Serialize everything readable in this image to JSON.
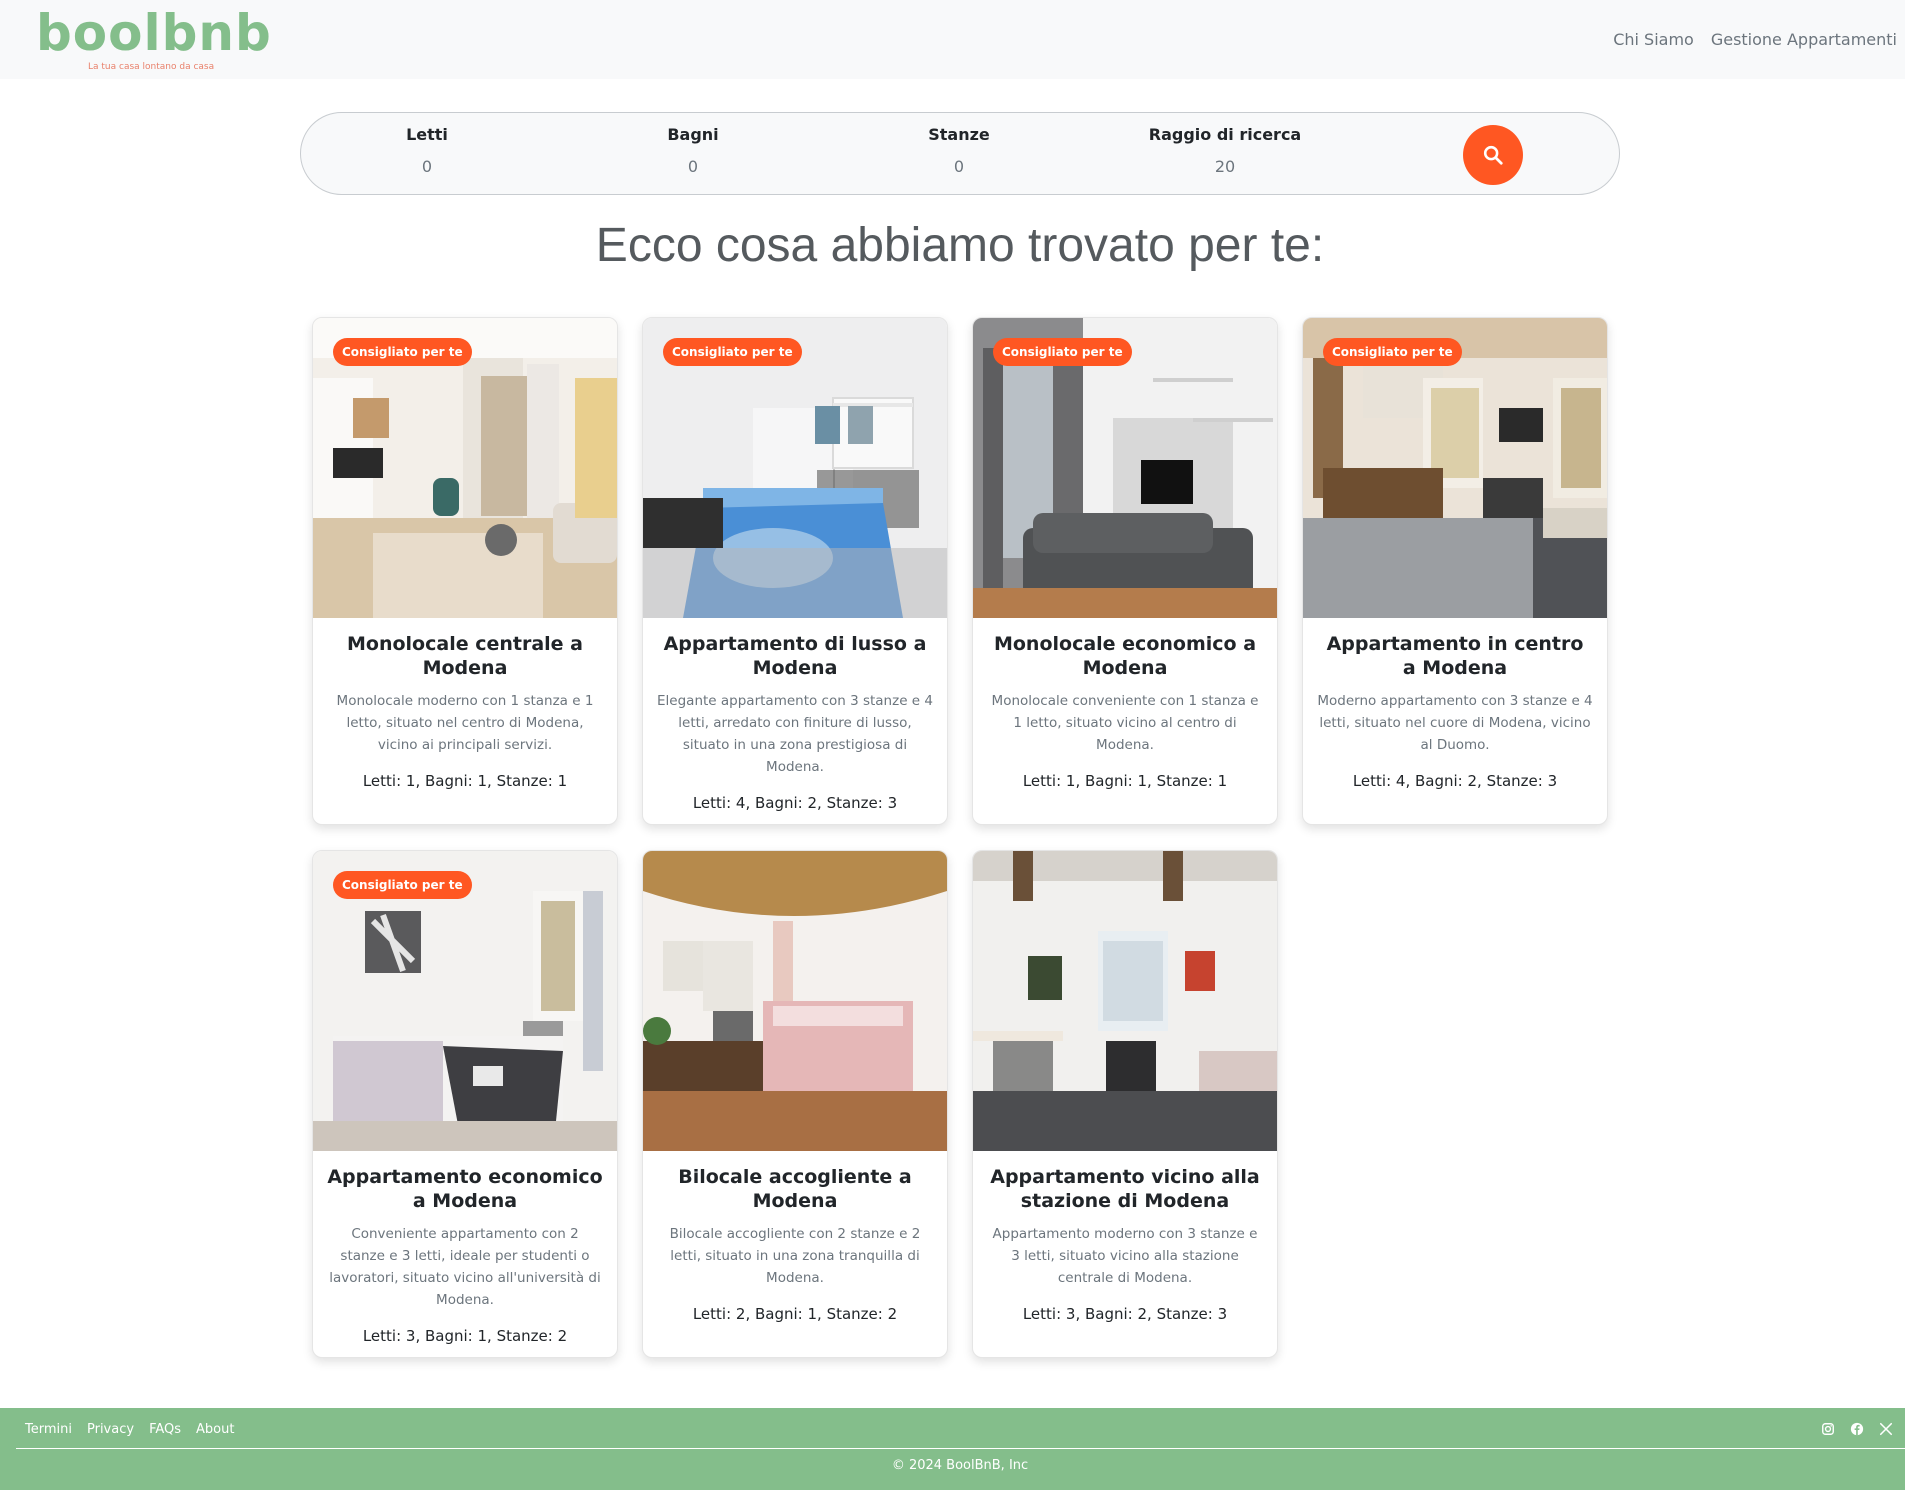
{
  "brand": {
    "logo_text": "boolbnb",
    "tagline": "La tua casa lontano da casa",
    "primary_color": "#84be8b",
    "accent_color": "#ff5722"
  },
  "nav": {
    "links": [
      "Chi Siamo",
      "Gestione Appartamenti"
    ]
  },
  "search": {
    "fields": [
      {
        "label": "Letti",
        "value": "0"
      },
      {
        "label": "Bagni",
        "value": "0"
      },
      {
        "label": "Stanze",
        "value": "0"
      },
      {
        "label": "Raggio di ricerca",
        "value": "20"
      }
    ],
    "button_icon": "search-icon"
  },
  "results_heading": "Ecco cosa abbiamo trovato per te:",
  "badge_label": "Consigliato per te",
  "apartments": [
    {
      "title": "Monolocale centrale a Modena",
      "description": "Monolocale moderno con 1 stanza e 1 letto, situato nel centro di Modena, vicino ai principali servizi.",
      "specs": "Letti: 1, Bagni: 1, Stanze: 1",
      "recommended": true
    },
    {
      "title": "Appartamento di lusso a Modena",
      "description": "Elegante appartamento con 3 stanze e 4 letti, arredato con finiture di lusso, situato in una zona prestigiosa di Modena.",
      "specs": "Letti: 4, Bagni: 2, Stanze: 3",
      "recommended": true
    },
    {
      "title": "Monolocale economico a Modena",
      "description": "Monolocale conveniente con 1 stanza e 1 letto, situato vicino al centro di Modena.",
      "specs": "Letti: 1, Bagni: 1, Stanze: 1",
      "recommended": true
    },
    {
      "title": "Appartamento in centro a Modena",
      "description": "Moderno appartamento con 3 stanze e 4 letti, situato nel cuore di Modena, vicino al Duomo.",
      "specs": "Letti: 4, Bagni: 2, Stanze: 3",
      "recommended": true
    },
    {
      "title": "Appartamento economico a Modena",
      "description": "Conveniente appartamento con 2 stanze e 3 letti, ideale per studenti o lavoratori, situato vicino all'università di Modena.",
      "specs": "Letti: 3, Bagni: 1, Stanze: 2",
      "recommended": true
    },
    {
      "title": "Bilocale accogliente a Modena",
      "description": "Bilocale accogliente con 2 stanze e 2 letti, situato in una zona tranquilla di Modena.",
      "specs": "Letti: 2, Bagni: 1, Stanze: 2",
      "recommended": false
    },
    {
      "title": "Appartamento vicino alla stazione di Modena",
      "description": "Appartamento moderno con 3 stanze e 3 letti, situato vicino alla stazione centrale di Modena.",
      "specs": "Letti: 3, Bagni: 2, Stanze: 3",
      "recommended": false
    }
  ],
  "footer": {
    "links": [
      "Termini",
      "Privacy",
      "FAQs",
      "About"
    ],
    "social_icons": [
      "instagram-icon",
      "facebook-icon",
      "x-icon"
    ],
    "copyright": "© 2024 BoolBnB, Inc"
  }
}
